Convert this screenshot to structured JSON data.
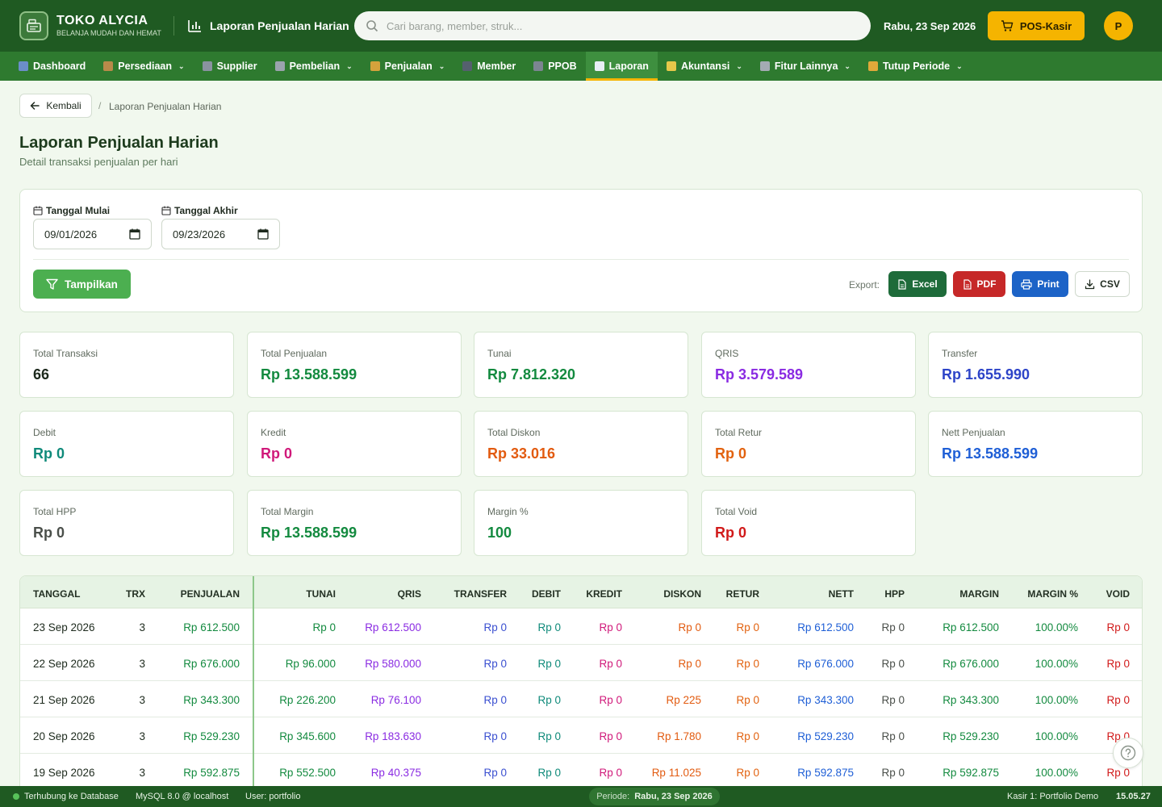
{
  "header": {
    "brand_name": "TOKO ALYCIA",
    "brand_tagline": "BELANJA MUDAH DAN HEMAT",
    "page_title": "Laporan Penjualan Harian",
    "search_placeholder": "Cari barang, member, struk...",
    "date": "Rabu, 23 Sep 2026",
    "pos_label": "POS-Kasir",
    "avatar_initial": "P"
  },
  "nav": [
    {
      "label": "Dashboard",
      "icon": "dashboard-icon",
      "color": "#6b8ec9",
      "dropdown": false
    },
    {
      "label": "Persediaan",
      "icon": "box-icon",
      "color": "#b88a4a",
      "dropdown": true
    },
    {
      "label": "Supplier",
      "icon": "factory-icon",
      "color": "#8a93a0",
      "dropdown": false
    },
    {
      "label": "Pembelian",
      "icon": "cash-register-icon",
      "color": "#9aa3ad",
      "dropdown": true
    },
    {
      "label": "Penjualan",
      "icon": "money-bag-icon",
      "color": "#d3a23c",
      "dropdown": true
    },
    {
      "label": "Member",
      "icon": "people-icon",
      "color": "#55606e",
      "dropdown": false
    },
    {
      "label": "PPOB",
      "icon": "phone-icon",
      "color": "#7c8591",
      "dropdown": false
    },
    {
      "label": "Laporan",
      "icon": "chart-icon",
      "color": "#e8eef6",
      "dropdown": false,
      "active": true
    },
    {
      "label": "Akuntansi",
      "icon": "ledger-icon",
      "color": "#e6c84a",
      "dropdown": true
    },
    {
      "label": "Fitur Lainnya",
      "icon": "gear-icon",
      "color": "#a4abb3",
      "dropdown": true
    },
    {
      "label": "Tutup Periode",
      "icon": "lock-icon",
      "color": "#e0a93a",
      "dropdown": true
    }
  ],
  "breadcrumb": {
    "back_label": "Kembali",
    "separator": "/",
    "current": "Laporan Penjualan Harian"
  },
  "page": {
    "title": "Laporan Penjualan Harian",
    "subtitle": "Detail transaksi penjualan per hari"
  },
  "filter": {
    "start_label": "Tanggal Mulai",
    "start_value": "09/01/2026",
    "end_label": "Tanggal Akhir",
    "end_value": "09/23/2026",
    "submit_label": "Tampilkan",
    "export_label": "Export:",
    "excel_label": "Excel",
    "pdf_label": "PDF",
    "print_label": "Print",
    "csv_label": "CSV"
  },
  "stats": [
    {
      "label": "Total Transaksi",
      "value": "66",
      "color": "#1d2a1d"
    },
    {
      "label": "Total Penjualan",
      "value": "Rp 13.588.599",
      "color": "#138a3f"
    },
    {
      "label": "Tunai",
      "value": "Rp 7.812.320",
      "color": "#138a3f"
    },
    {
      "label": "QRIS",
      "value": "Rp 3.579.589",
      "color": "#8a2be2"
    },
    {
      "label": "Transfer",
      "value": "Rp 1.655.990",
      "color": "#2d44c8"
    },
    {
      "label": "Debit",
      "value": "Rp 0",
      "color": "#0f8a7a"
    },
    {
      "label": "Kredit",
      "value": "Rp 0",
      "color": "#d0197a"
    },
    {
      "label": "Total Diskon",
      "value": "Rp 33.016",
      "color": "#e25b10"
    },
    {
      "label": "Total Retur",
      "value": "Rp 0",
      "color": "#e2620f"
    },
    {
      "label": "Nett Penjualan",
      "value": "Rp 13.588.599",
      "color": "#1f5fd6"
    },
    {
      "label": "Total HPP",
      "value": "Rp 0",
      "color": "#4a4f4a"
    },
    {
      "label": "Total Margin",
      "value": "Rp 13.588.599",
      "color": "#138a3f"
    },
    {
      "label": "Margin %",
      "value": "100",
      "color": "#138a3f"
    },
    {
      "label": "Total Void",
      "value": "Rp 0",
      "color": "#d11a1a"
    }
  ],
  "table": {
    "columns": [
      "TANGGAL",
      "TRX",
      "PENJUALAN",
      "TUNAI",
      "QRIS",
      "TRANSFER",
      "DEBIT",
      "KREDIT",
      "DISKON",
      "RETUR",
      "NETT",
      "HPP",
      "MARGIN",
      "MARGIN %",
      "VOID"
    ],
    "rows": [
      [
        "23 Sep 2026",
        "3",
        "Rp 612.500",
        "Rp 0",
        "Rp 612.500",
        "Rp 0",
        "Rp 0",
        "Rp 0",
        "Rp 0",
        "Rp 0",
        "Rp 612.500",
        "Rp 0",
        "Rp 612.500",
        "100.00%",
        "Rp 0"
      ],
      [
        "22 Sep 2026",
        "3",
        "Rp 676.000",
        "Rp 96.000",
        "Rp 580.000",
        "Rp 0",
        "Rp 0",
        "Rp 0",
        "Rp 0",
        "Rp 0",
        "Rp 676.000",
        "Rp 0",
        "Rp 676.000",
        "100.00%",
        "Rp 0"
      ],
      [
        "21 Sep 2026",
        "3",
        "Rp 343.300",
        "Rp 226.200",
        "Rp 76.100",
        "Rp 0",
        "Rp 0",
        "Rp 0",
        "Rp 225",
        "Rp 0",
        "Rp 343.300",
        "Rp 0",
        "Rp 343.300",
        "100.00%",
        "Rp 0"
      ],
      [
        "20 Sep 2026",
        "3",
        "Rp 529.230",
        "Rp 345.600",
        "Rp 183.630",
        "Rp 0",
        "Rp 0",
        "Rp 0",
        "Rp 1.780",
        "Rp 0",
        "Rp 529.230",
        "Rp 0",
        "Rp 529.230",
        "100.00%",
        "Rp 0"
      ],
      [
        "19 Sep 2026",
        "3",
        "Rp 592.875",
        "Rp 552.500",
        "Rp 40.375",
        "Rp 0",
        "Rp 0",
        "Rp 0",
        "Rp 11.025",
        "Rp 0",
        "Rp 592.875",
        "Rp 0",
        "Rp 592.875",
        "100.00%",
        "Rp 0"
      ]
    ],
    "column_colors": [
      "#1d2a1d",
      "#1d2a1d",
      "#138a3f",
      "#138a3f",
      "#8a2be2",
      "#3a4fd0",
      "#0f8a7a",
      "#d0197a",
      "#e25b10",
      "#e2620f",
      "#1f5fd6",
      "#4a4f4a",
      "#138a3f",
      "#138a3f",
      "#d11a1a"
    ]
  },
  "status": {
    "db": "Terhubung ke Database",
    "mysql": "MySQL 8.0 @ localhost",
    "user": "User: portfolio",
    "periode_label": "Periode:",
    "periode_value": "Rabu, 23 Sep 2026",
    "kasir": "Kasir 1: Portfolio Demo",
    "time": "15.05.27"
  }
}
